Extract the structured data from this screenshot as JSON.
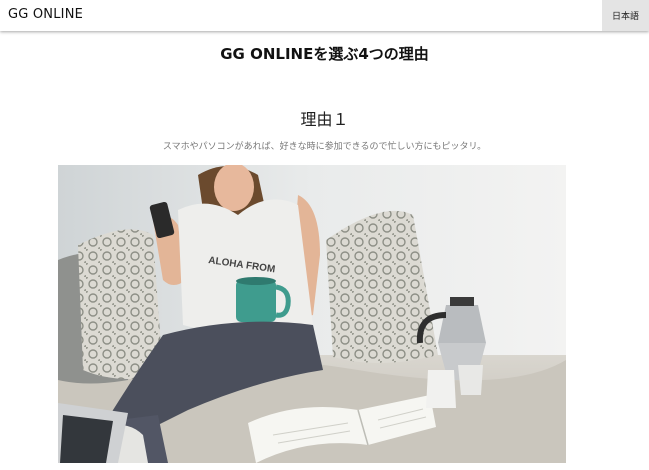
{
  "header": {
    "brand": "GG ONLINE",
    "language_button": "日本語"
  },
  "main": {
    "title": "GG ONLINEを選ぶ4つの理由",
    "reason": {
      "heading": "理由１",
      "description": "スマホやパソコンがあれば、好きな時に参加できるので忙しい方にもピッタリ。",
      "mug_text": "ALOHA FROM"
    }
  }
}
